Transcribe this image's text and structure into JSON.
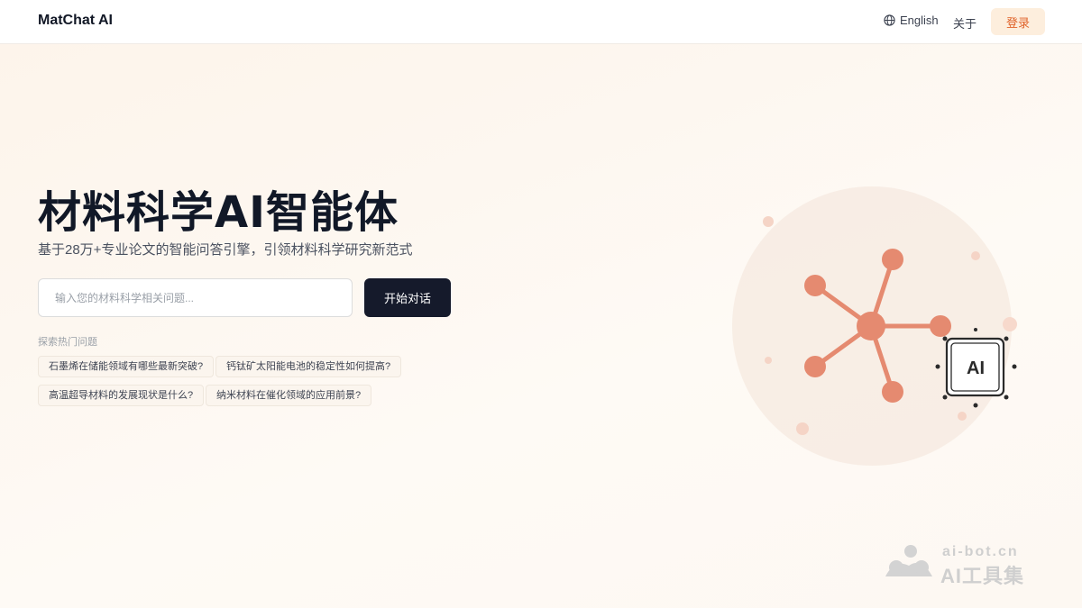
{
  "header": {
    "brand": "MatChat AI",
    "language": "English",
    "about": "关于",
    "login": "登录",
    "language_icon": "globe-icon"
  },
  "hero": {
    "title": "材料科学AI智能体",
    "subtitle": "基于28万+专业论文的智能问答引擎，引领材料科学研究新范式",
    "search_placeholder": "输入您的材料科学相关问题...",
    "start_button": "开始对话",
    "hot_label": "探索热门问题",
    "hot_questions": [
      "石墨烯在储能领域有哪些最新突破?",
      "钙钛矿太阳能电池的稳定性如何提高?",
      "高温超导材料的发展现状是什么?",
      "纳米材料在催化领域的应用前景?"
    ]
  },
  "illustration": {
    "chip_label": "AI",
    "icon": "molecule-network-icon"
  },
  "watermark": {
    "domain": "ai-bot.cn",
    "name": "AI工具集"
  },
  "colors": {
    "accent": "#e58a70",
    "brand_dark": "#151a2b",
    "login_bg": "#fdeedd",
    "login_text": "#e0632a"
  }
}
